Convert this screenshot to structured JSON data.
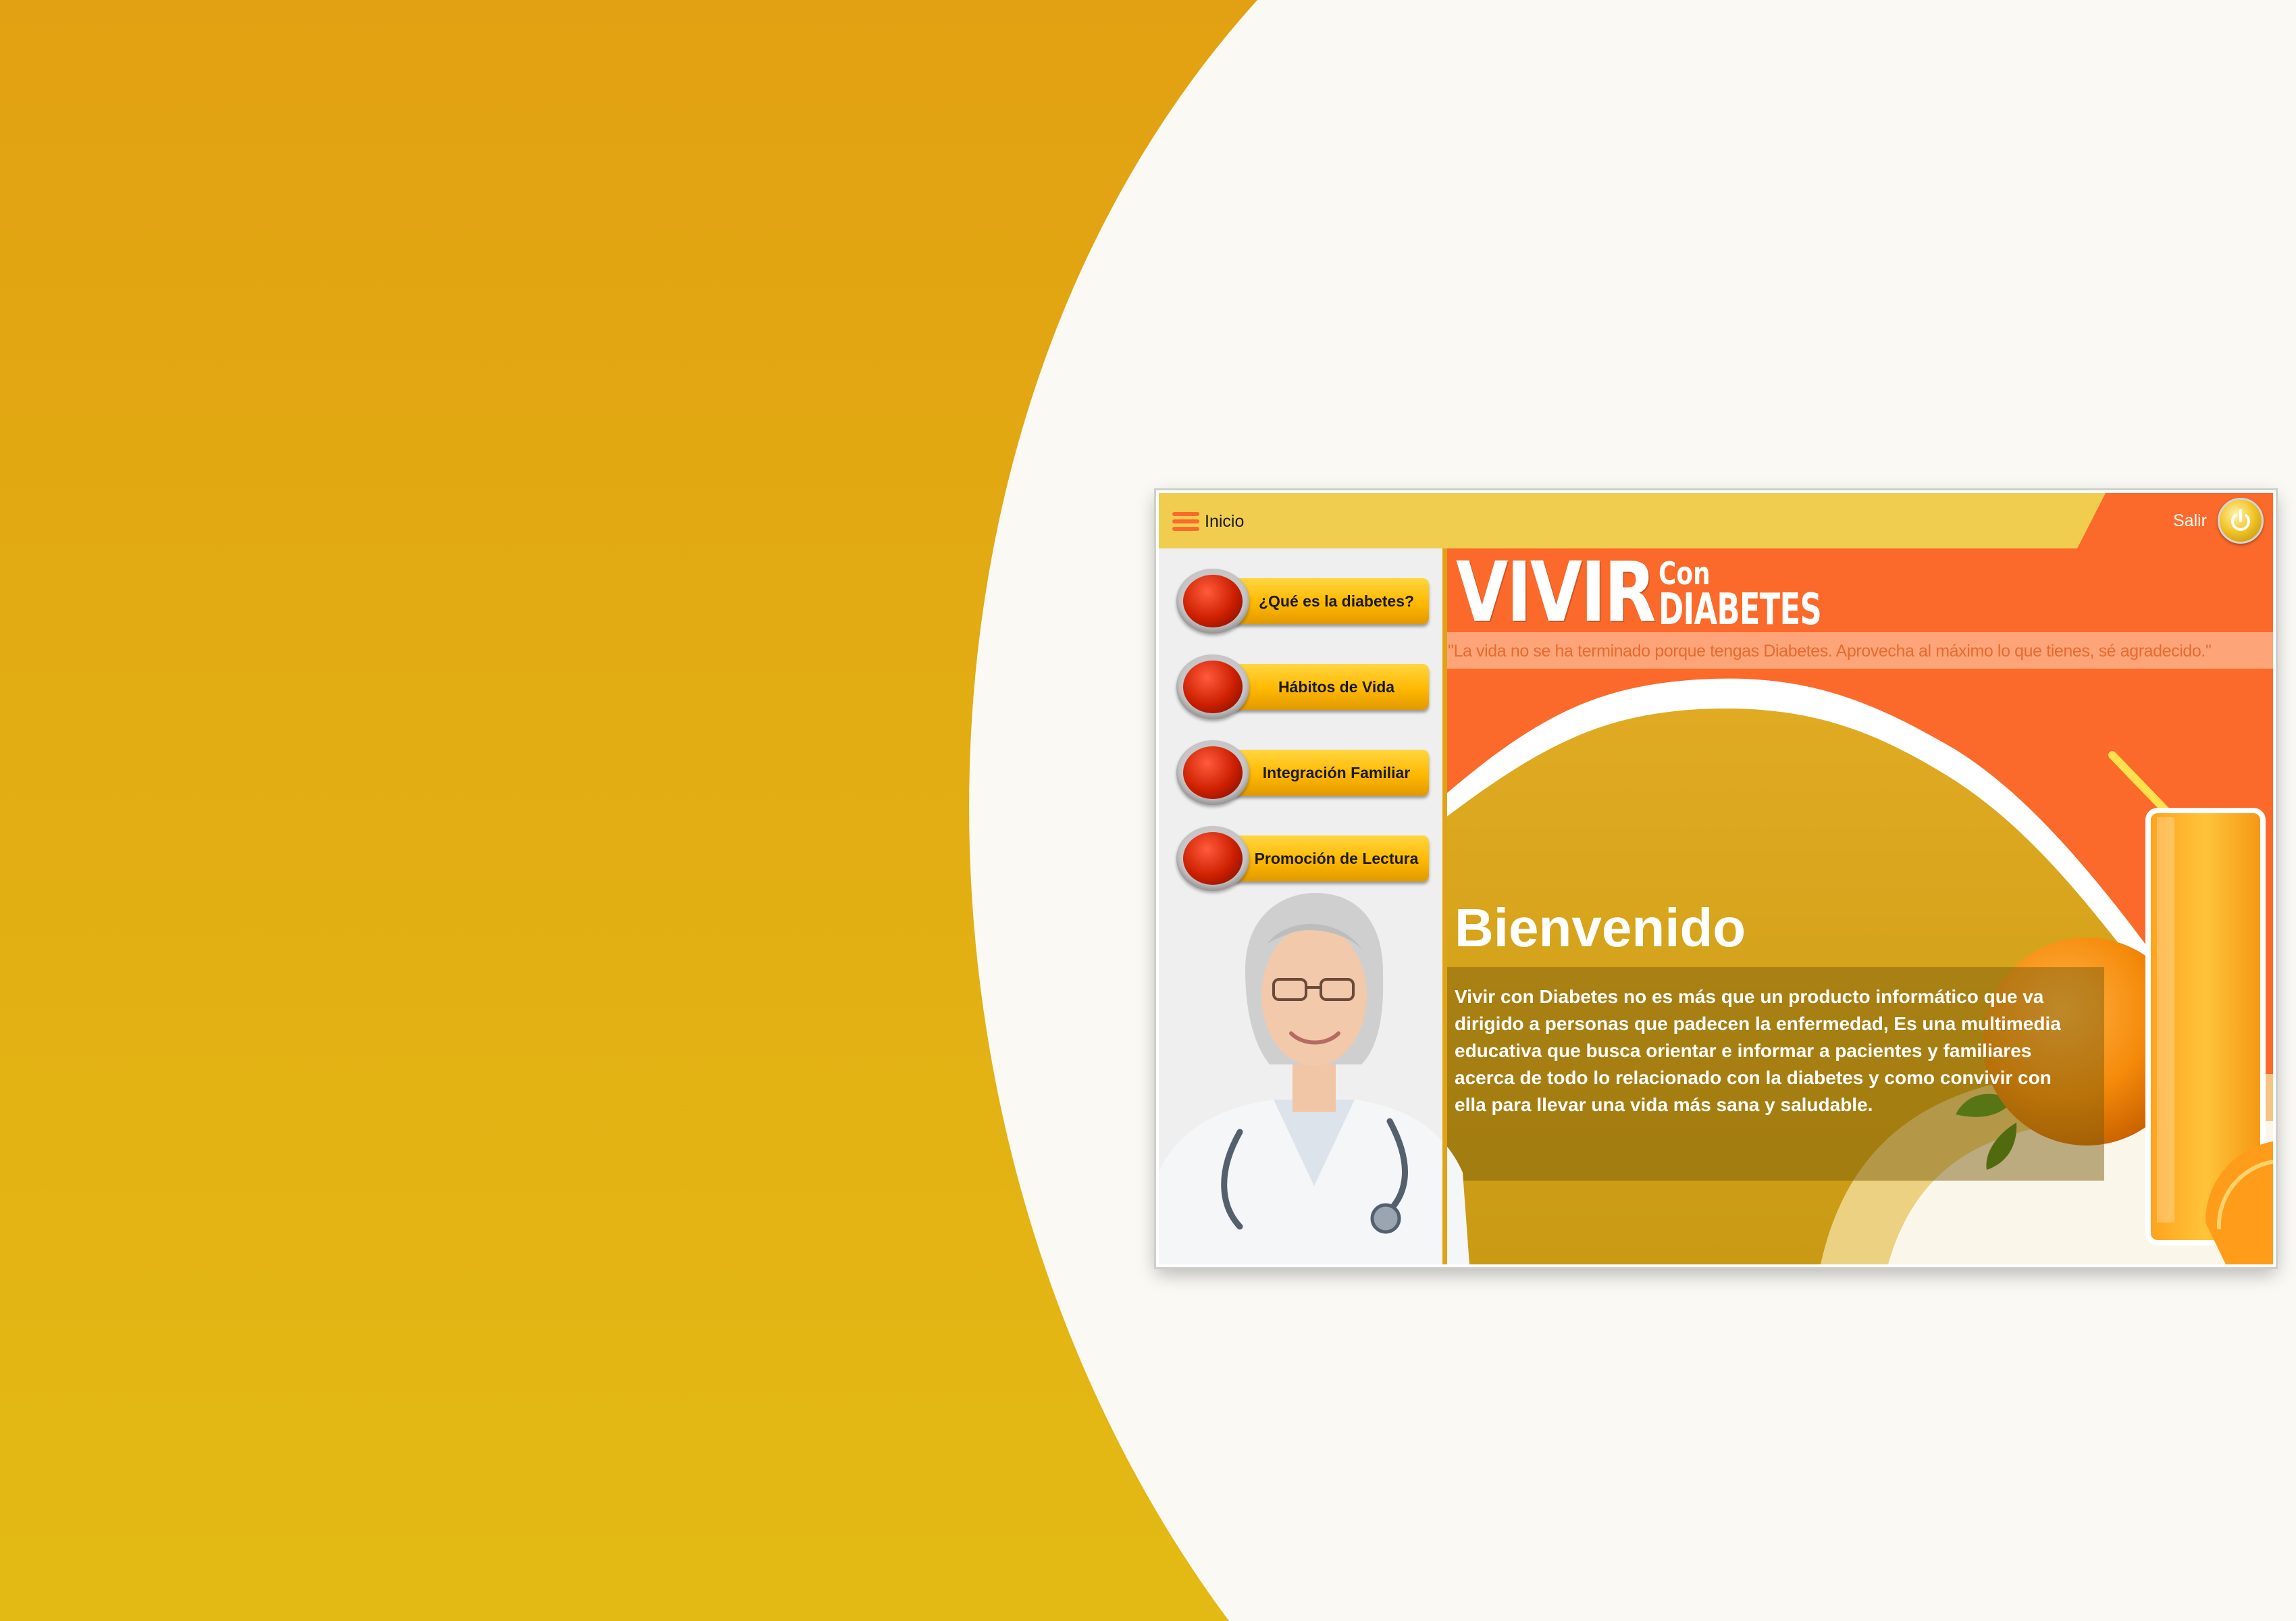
{
  "colors": {
    "background_left": "#e2a112",
    "background_right": "#faf9f4",
    "topbar": "#f1cd4f",
    "accent_orange": "#fb6a2a",
    "button_yellow": "#ffb800",
    "button_red": "#cc1f00",
    "content_gold": "#d8a81e"
  },
  "window": {
    "menu_label": "Inicio",
    "exit_label": "Salir",
    "menu_icon": "hamburger-menu-icon",
    "exit_icon": "power-icon"
  },
  "nav": {
    "items": [
      {
        "label": "¿Qué es la diabetes?",
        "icon": "red-round-button"
      },
      {
        "label": "Hábitos de Vida",
        "icon": "red-round-button"
      },
      {
        "label": "Integración Familiar",
        "icon": "red-round-button"
      },
      {
        "label": "Promoción de Lectura",
        "icon": "red-round-button"
      }
    ]
  },
  "header": {
    "logo_big": "VIVIR",
    "logo_con": "Con",
    "logo_diabetes": "DIABETES",
    "quote": "\"La vida no se ha terminado porque tengas Diabetes. Aprovecha al máximo lo que tienes, sé agradecido.\""
  },
  "welcome": {
    "title": "Bienvenido",
    "body": "Vivir con Diabetes no es más que un producto informático que va dirigido a personas que padecen la enfermedad, Es una multimedia educativa que busca orientar e informar a pacientes y familiares acerca de todo lo relacionado con la diabetes y como convivir con ella para llevar una vida más sana y saludable."
  },
  "images": {
    "doctor": "smiling-doctor-with-stethoscope",
    "decor": [
      "orange-juice-glass",
      "orange-fruit",
      "orange-slice",
      "leaves"
    ]
  }
}
